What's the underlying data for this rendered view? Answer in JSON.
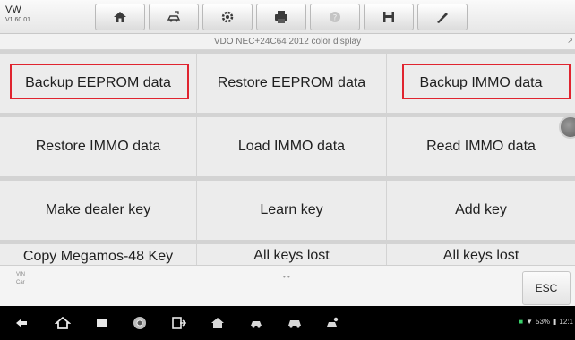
{
  "header": {
    "make": "VW",
    "version": "V1.60.01",
    "tools": [
      {
        "icon": "home-icon"
      },
      {
        "icon": "vehicle-swap-icon"
      },
      {
        "icon": "settings-gear-icon"
      },
      {
        "icon": "print-icon"
      },
      {
        "icon": "help-icon"
      },
      {
        "icon": "save-icon"
      },
      {
        "icon": "pen-icon"
      }
    ]
  },
  "subtitle": "VDO NEC+24C64 2012 color display",
  "subtitle_icon": "↗",
  "functions": [
    [
      "Backup EEPROM data",
      "Restore EEPROM data",
      "Backup IMMO data"
    ],
    [
      "Restore IMMO data",
      "Load IMMO data",
      "Read IMMO data"
    ],
    [
      "Make dealer key",
      "Learn key",
      "Add key"
    ],
    [
      "Copy Megamos-48 Key",
      "All keys lost",
      "All keys lost"
    ]
  ],
  "highlighted": [
    "Backup EEPROM data",
    "Backup IMMO data"
  ],
  "highlight_color": "#e0242f",
  "footer": {
    "vin_label": "VIN",
    "car_label": "Car",
    "page_dots": "• •",
    "esc_label": "ESC"
  },
  "navbar": {
    "icons": [
      "back-icon",
      "home-icon",
      "recent-apps-icon",
      "chrome-icon",
      "screen-cast-icon",
      "maxisys-home-icon",
      "car-service-icon",
      "car-icon",
      "people-car-icon"
    ],
    "battery": "53%",
    "time": "12:1"
  }
}
